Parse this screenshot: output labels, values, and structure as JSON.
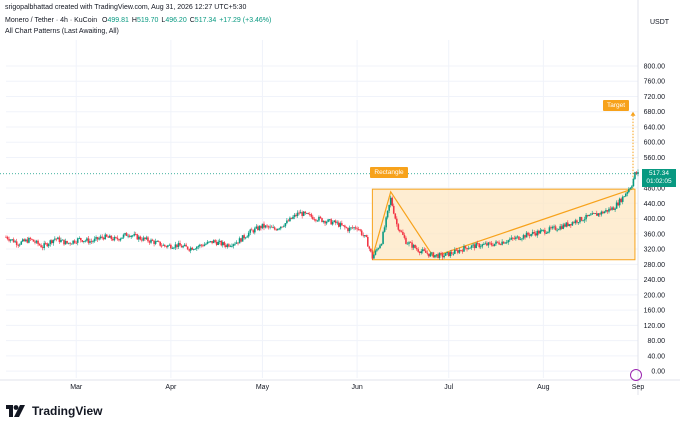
{
  "header": {
    "credit": "srigopalbhattad created with TradingView.com, Aug 31, 2026 12:27 UTC+5:30",
    "symbol": "Monero / Tether · 4h · KuCoin",
    "ohlc": [
      {
        "k": "O",
        "v": "499.81"
      },
      {
        "k": "H",
        "v": "519.70"
      },
      {
        "k": "L",
        "v": "496.20"
      },
      {
        "k": "C",
        "v": "517.34"
      },
      {
        "k": "",
        "v": "+17.29 (+3.46%)"
      }
    ],
    "indicator": "All Chart Patterns (Last Awaiting, All)"
  },
  "currency": "USDT",
  "brand": "TradingView",
  "colors": {
    "up": "#089981",
    "down": "#f23645",
    "pattern": "#f7a21b",
    "fill": "#fde7c3",
    "grid": "#f0f3fa"
  },
  "price_tag": {
    "price": "517.34",
    "countdown": "01:02:05"
  },
  "annotations": {
    "rectangle": "Rectangle",
    "target": "Target"
  },
  "chart_data": {
    "type": "candlestick",
    "y_ticks": [
      0,
      40,
      80,
      120,
      160,
      200,
      240,
      280,
      320,
      360,
      400,
      440,
      480,
      560,
      600,
      640,
      680,
      720,
      760,
      800
    ],
    "y_tick_labels": [
      "0.00",
      "40.00",
      "80.00",
      "120.00",
      "160.00",
      "200.00",
      "240.00",
      "280.00",
      "320.00",
      "360.00",
      "400.00",
      "440.00",
      "480.00",
      "560.00",
      "600.00",
      "640.00",
      "680.00",
      "720.00",
      "760.00",
      "800.00"
    ],
    "ylim": [
      -18,
      868
    ],
    "x_labels": [
      {
        "label": "Mar",
        "date": "2026-03-01"
      },
      {
        "label": "Apr",
        "date": "2026-04-01"
      },
      {
        "label": "May",
        "date": "2026-05-01"
      },
      {
        "label": "Jun",
        "date": "2026-06-01"
      },
      {
        "label": "Jul",
        "date": "2026-07-01"
      },
      {
        "label": "Aug",
        "date": "2026-08-01"
      },
      {
        "label": "Sep",
        "date": "2026-09-01"
      }
    ],
    "xlim": [
      "2026-02-06",
      "2026-09-01"
    ],
    "last_price": 517.34,
    "price_path": [
      [
        "2026-02-06",
        352
      ],
      [
        "2026-02-10",
        335
      ],
      [
        "2026-02-14",
        345
      ],
      [
        "2026-02-18",
        326
      ],
      [
        "2026-02-22",
        348
      ],
      [
        "2026-02-26",
        335
      ],
      [
        "2026-03-02",
        346
      ],
      [
        "2026-03-06",
        340
      ],
      [
        "2026-03-10",
        352
      ],
      [
        "2026-03-14",
        345
      ],
      [
        "2026-03-18",
        360
      ],
      [
        "2026-03-22",
        348
      ],
      [
        "2026-03-26",
        340
      ],
      [
        "2026-03-30",
        328
      ],
      [
        "2026-04-03",
        330
      ],
      [
        "2026-04-07",
        322
      ],
      [
        "2026-04-11",
        330
      ],
      [
        "2026-04-15",
        340
      ],
      [
        "2026-04-19",
        330
      ],
      [
        "2026-04-23",
        340
      ],
      [
        "2026-04-27",
        365
      ],
      [
        "2026-05-01",
        380
      ],
      [
        "2026-05-05",
        372
      ],
      [
        "2026-05-09",
        390
      ],
      [
        "2026-05-13",
        415
      ],
      [
        "2026-05-17",
        405
      ],
      [
        "2026-05-21",
        395
      ],
      [
        "2026-05-25",
        388
      ],
      [
        "2026-05-29",
        372
      ],
      [
        "2026-06-01",
        378
      ],
      [
        "2026-06-04",
        345
      ],
      [
        "2026-06-06",
        298
      ],
      [
        "2026-06-09",
        340
      ],
      [
        "2026-06-12",
        452
      ],
      [
        "2026-06-14",
        385
      ],
      [
        "2026-06-17",
        340
      ],
      [
        "2026-06-21",
        318
      ],
      [
        "2026-06-25",
        305
      ],
      [
        "2026-06-29",
        302
      ],
      [
        "2026-07-03",
        312
      ],
      [
        "2026-07-07",
        325
      ],
      [
        "2026-07-11",
        330
      ],
      [
        "2026-07-15",
        332
      ],
      [
        "2026-07-19",
        340
      ],
      [
        "2026-07-23",
        348
      ],
      [
        "2026-07-27",
        358
      ],
      [
        "2026-07-31",
        365
      ],
      [
        "2026-08-04",
        372
      ],
      [
        "2026-08-08",
        382
      ],
      [
        "2026-08-12",
        395
      ],
      [
        "2026-08-16",
        405
      ],
      [
        "2026-08-20",
        415
      ],
      [
        "2026-08-24",
        428
      ],
      [
        "2026-08-27",
        455
      ],
      [
        "2026-08-30",
        490
      ],
      [
        "2026-08-31",
        517.34
      ]
    ],
    "pattern": {
      "name": "Rectangle",
      "box": {
        "x1": "2026-06-06",
        "x2": "2026-08-31",
        "y1": 292,
        "y2": 477
      },
      "zigzag": [
        [
          "2026-06-06",
          298
        ],
        [
          "2026-06-12",
          470
        ],
        [
          "2026-06-26",
          300
        ],
        [
          "2026-08-30",
          477
        ]
      ],
      "target": 680
    }
  }
}
